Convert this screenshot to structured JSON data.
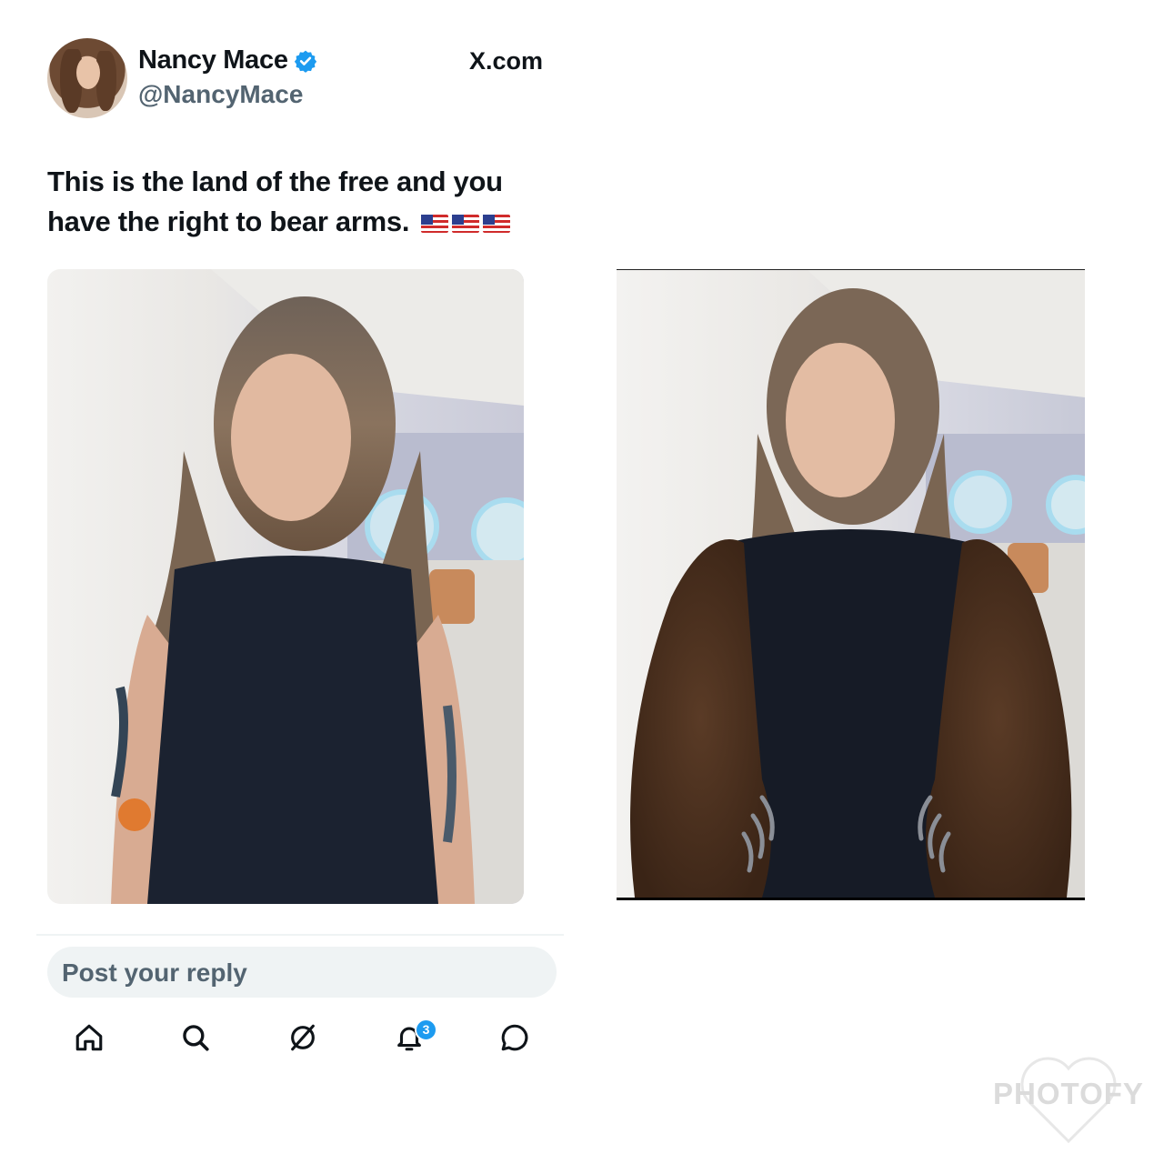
{
  "post": {
    "author_name": "Nancy Mace",
    "author_handle": "@NancyMace",
    "source_label": "X.com",
    "text": "This is the land of the free and you have the right to bear arms.",
    "text_emoji": "🇺🇸🇺🇸🇺🇸"
  },
  "reply": {
    "placeholder": "Post your reply"
  },
  "bottom_nav": {
    "items": [
      "home-icon",
      "search-icon",
      "grok-icon",
      "notifications-icon",
      "messages-icon"
    ],
    "notification_count": "3"
  },
  "watermark": {
    "text": "PHOTOFY"
  },
  "colors": {
    "verified_blue": "#1d9bf0",
    "muted_text": "#536471",
    "reply_bg": "#eff3f4"
  }
}
